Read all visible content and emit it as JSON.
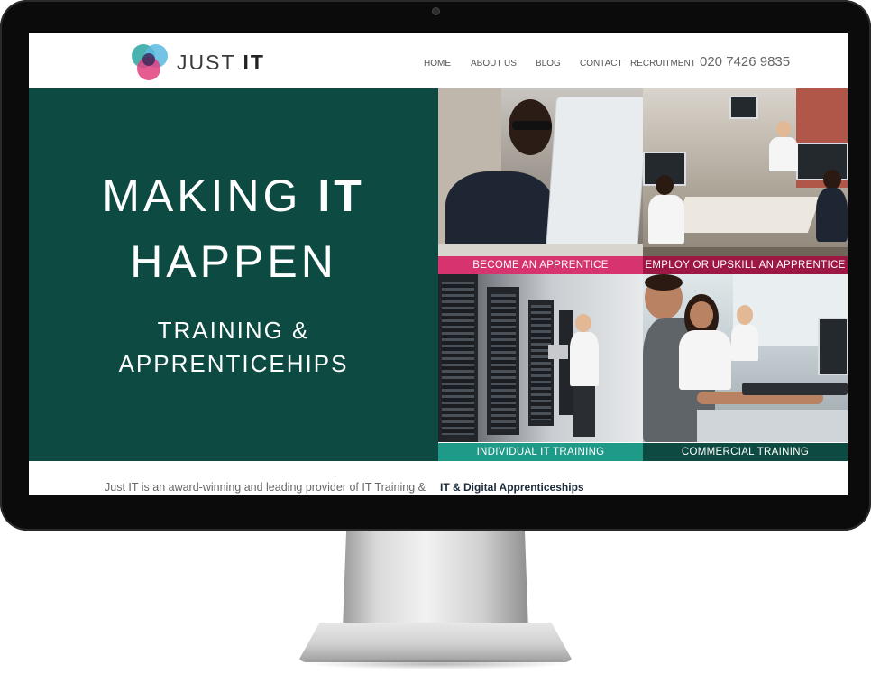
{
  "brand": {
    "logo_text_light": "JUST",
    "logo_text_bold": "IT"
  },
  "nav": {
    "home": "HOME",
    "about": "ABOUT US",
    "blog": "BLOG",
    "contact": "CONTACT",
    "recruitment": "RECRUITMENT"
  },
  "phone": "020 7426 9835",
  "hero": {
    "line1_light": "MAKING",
    "line1_bold": "IT",
    "line2": "HAPPEN",
    "sub1": "TRAINING &",
    "sub2": "APPRENTICEHIPS"
  },
  "tiles": [
    {
      "label": "BECOME AN APPRENTICE",
      "color": "#d7336f"
    },
    {
      "label": "EMPLOY OR UPSKILL AN APPRENTICE",
      "color": "#9c1744"
    },
    {
      "label": "INDIVIDUAL IT TRAINING",
      "color": "#1f9a88"
    },
    {
      "label": "COMMERCIAL TRAINING",
      "color": "#0d4a41"
    }
  ],
  "intro": {
    "text": "Just IT is an award-winning and leading provider of IT Training &",
    "heading": "IT & Digital Apprenticeships"
  },
  "colors": {
    "hero_bg": "#0d4a41",
    "pink": "#d7336f",
    "maroon": "#9c1744",
    "teal": "#1f9a88"
  }
}
